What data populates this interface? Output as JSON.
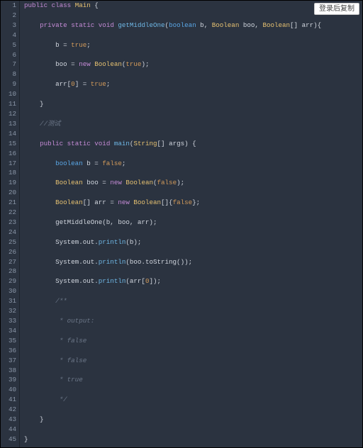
{
  "copy_button_label": "登录后复制",
  "lines": [
    [
      {
        "c": "c-kw1",
        "t": "public"
      },
      {
        "c": "c-pun",
        "t": " "
      },
      {
        "c": "c-kw1",
        "t": "class"
      },
      {
        "c": "c-pun",
        "t": " "
      },
      {
        "c": "c-type",
        "t": "Main"
      },
      {
        "c": "c-pun",
        "t": " {"
      }
    ],
    [],
    [
      {
        "c": "c-pun",
        "t": "    "
      },
      {
        "c": "c-kw1",
        "t": "private"
      },
      {
        "c": "c-pun",
        "t": " "
      },
      {
        "c": "c-kw1",
        "t": "static"
      },
      {
        "c": "c-pun",
        "t": " "
      },
      {
        "c": "c-kw1",
        "t": "void"
      },
      {
        "c": "c-pun",
        "t": " "
      },
      {
        "c": "c-fn",
        "t": "getMiddleOne"
      },
      {
        "c": "c-pun",
        "t": "("
      },
      {
        "c": "c-kw2",
        "t": "boolean"
      },
      {
        "c": "c-pun",
        "t": " b, "
      },
      {
        "c": "c-type",
        "t": "Boolean"
      },
      {
        "c": "c-pun",
        "t": " boo, "
      },
      {
        "c": "c-type",
        "t": "Boolean"
      },
      {
        "c": "c-pun",
        "t": "[] arr){"
      }
    ],
    [],
    [
      {
        "c": "c-pun",
        "t": "        b = "
      },
      {
        "c": "c-lit",
        "t": "true"
      },
      {
        "c": "c-pun",
        "t": ";"
      }
    ],
    [],
    [
      {
        "c": "c-pun",
        "t": "        boo = "
      },
      {
        "c": "c-kw1",
        "t": "new"
      },
      {
        "c": "c-pun",
        "t": " "
      },
      {
        "c": "c-type",
        "t": "Boolean"
      },
      {
        "c": "c-pun",
        "t": "("
      },
      {
        "c": "c-lit",
        "t": "true"
      },
      {
        "c": "c-pun",
        "t": ");"
      }
    ],
    [],
    [
      {
        "c": "c-pun",
        "t": "        arr["
      },
      {
        "c": "c-lit",
        "t": "0"
      },
      {
        "c": "c-pun",
        "t": "] = "
      },
      {
        "c": "c-lit",
        "t": "true"
      },
      {
        "c": "c-pun",
        "t": ";"
      }
    ],
    [],
    [
      {
        "c": "c-pun",
        "t": "    }"
      }
    ],
    [],
    [
      {
        "c": "c-cmt",
        "t": "    //测试"
      }
    ],
    [],
    [
      {
        "c": "c-pun",
        "t": "    "
      },
      {
        "c": "c-kw1",
        "t": "public"
      },
      {
        "c": "c-pun",
        "t": " "
      },
      {
        "c": "c-kw1",
        "t": "static"
      },
      {
        "c": "c-pun",
        "t": " "
      },
      {
        "c": "c-kw1",
        "t": "void"
      },
      {
        "c": "c-pun",
        "t": " "
      },
      {
        "c": "c-fn",
        "t": "main"
      },
      {
        "c": "c-pun",
        "t": "("
      },
      {
        "c": "c-type",
        "t": "String"
      },
      {
        "c": "c-pun",
        "t": "[] args) {"
      }
    ],
    [],
    [
      {
        "c": "c-pun",
        "t": "        "
      },
      {
        "c": "c-kw2",
        "t": "boolean"
      },
      {
        "c": "c-pun",
        "t": " b = "
      },
      {
        "c": "c-lit",
        "t": "false"
      },
      {
        "c": "c-pun",
        "t": ";"
      }
    ],
    [],
    [
      {
        "c": "c-pun",
        "t": "        "
      },
      {
        "c": "c-type",
        "t": "Boolean"
      },
      {
        "c": "c-pun",
        "t": " boo = "
      },
      {
        "c": "c-kw1",
        "t": "new"
      },
      {
        "c": "c-pun",
        "t": " "
      },
      {
        "c": "c-type",
        "t": "Boolean"
      },
      {
        "c": "c-pun",
        "t": "("
      },
      {
        "c": "c-lit",
        "t": "false"
      },
      {
        "c": "c-pun",
        "t": ");"
      }
    ],
    [],
    [
      {
        "c": "c-pun",
        "t": "        "
      },
      {
        "c": "c-type",
        "t": "Boolean"
      },
      {
        "c": "c-pun",
        "t": "[] arr = "
      },
      {
        "c": "c-kw1",
        "t": "new"
      },
      {
        "c": "c-pun",
        "t": " "
      },
      {
        "c": "c-type",
        "t": "Boolean"
      },
      {
        "c": "c-pun",
        "t": "[]{"
      },
      {
        "c": "c-lit",
        "t": "false"
      },
      {
        "c": "c-pun",
        "t": "};"
      }
    ],
    [],
    [
      {
        "c": "c-pun",
        "t": "        getMiddleOne(b, boo, arr);"
      }
    ],
    [],
    [
      {
        "c": "c-pun",
        "t": "        System.out."
      },
      {
        "c": "c-fn",
        "t": "println"
      },
      {
        "c": "c-pun",
        "t": "(b);"
      }
    ],
    [],
    [
      {
        "c": "c-pun",
        "t": "        System.out."
      },
      {
        "c": "c-fn",
        "t": "println"
      },
      {
        "c": "c-pun",
        "t": "(boo.toString());"
      }
    ],
    [],
    [
      {
        "c": "c-pun",
        "t": "        System.out."
      },
      {
        "c": "c-fn",
        "t": "println"
      },
      {
        "c": "c-pun",
        "t": "(arr["
      },
      {
        "c": "c-lit",
        "t": "0"
      },
      {
        "c": "c-pun",
        "t": "]);"
      }
    ],
    [],
    [
      {
        "c": "c-cmt",
        "t": "        /**"
      }
    ],
    [],
    [
      {
        "c": "c-cmt",
        "t": "         * output:"
      }
    ],
    [],
    [
      {
        "c": "c-cmt",
        "t": "         * false"
      }
    ],
    [],
    [
      {
        "c": "c-cmt",
        "t": "         * false"
      }
    ],
    [],
    [
      {
        "c": "c-cmt",
        "t": "         * true"
      }
    ],
    [],
    [
      {
        "c": "c-cmt",
        "t": "         */"
      }
    ],
    [],
    [
      {
        "c": "c-pun",
        "t": "    }"
      }
    ],
    [],
    [
      {
        "c": "c-pun",
        "t": "}"
      }
    ]
  ]
}
